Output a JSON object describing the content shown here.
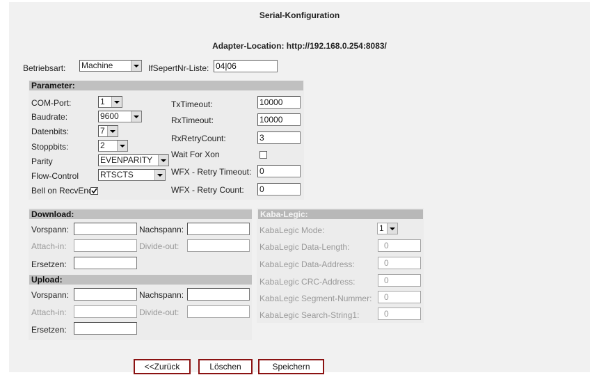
{
  "header": {
    "title": "Serial-Konfiguration",
    "adapter_location": "Adapter-Location: http://192.168.0.254:8083/"
  },
  "top": {
    "betriebsart_label": "Betriebsart:",
    "betriebsart_value": "Machine",
    "ifsepert_label": "IfSepertNr-Liste:",
    "ifsepert_value": "04|06"
  },
  "parameter": {
    "header": "Parameter:",
    "com_port_label": "COM-Port:",
    "com_port_value": "1",
    "baudrate_label": "Baudrate:",
    "baudrate_value": "9600",
    "datenbits_label": "Datenbits:",
    "datenbits_value": "7",
    "stoppbits_label": "Stoppbits:",
    "stoppbits_value": "2",
    "parity_label": "Parity",
    "parity_value": "EVENPARITY",
    "flow_control_label": "Flow-Control",
    "flow_control_value": "RTSCTS",
    "bell_label": "Bell on RecvEnd",
    "bell_checked": true,
    "tx_timeout_label": "TxTimeout:",
    "tx_timeout_value": "10000",
    "rx_timeout_label": "RxTimeout:",
    "rx_timeout_value": "10000",
    "rx_retry_label": "RxRetryCount:",
    "rx_retry_value": "3",
    "wait_xon_label": "Wait For Xon",
    "wait_xon_checked": false,
    "wfx_timeout_label": "WFX - Retry Timeout:",
    "wfx_timeout_value": "0",
    "wfx_count_label": "WFX - Retry Count:",
    "wfx_count_value": "0"
  },
  "download": {
    "header": "Download:",
    "vorspann_label": "Vorspann:",
    "vorspann_value": "",
    "nachspann_label": "Nachspann:",
    "nachspann_value": "",
    "attach_label": "Attach-in:",
    "attach_value": "",
    "divide_label": "Divide-out:",
    "divide_value": "",
    "ersetzen_label": "Ersetzen:",
    "ersetzen_value": ""
  },
  "upload": {
    "header": "Upload:",
    "vorspann_label": "Vorspann:",
    "vorspann_value": "",
    "nachspann_label": "Nachspann:",
    "nachspann_value": "",
    "attach_label": "Attach-in:",
    "attach_value": "",
    "divide_label": "Divide-out:",
    "divide_value": "",
    "ersetzen_label": "Ersetzen:",
    "ersetzen_value": ""
  },
  "kabalegic": {
    "header": "Kaba-Legic:",
    "mode_label": "KabaLegic Mode:",
    "mode_value": "1",
    "data_length_label": "KabaLegic Data-Length:",
    "data_length_value": "0",
    "data_address_label": "KabaLegic Data-Address:",
    "data_address_value": "0",
    "crc_address_label": "KabaLegic CRC-Address:",
    "crc_address_value": "0",
    "segment_label": "KabaLegic Segment-Nummer:",
    "segment_value": "0",
    "search_label": "KabaLegic Search-String1:",
    "search_value": "0"
  },
  "buttons": {
    "back": "<<Zurück",
    "delete": "Löschen",
    "save": "Speichern"
  },
  "colors": {
    "page_bg": "#f1f1f1",
    "section_header": "#c0c0c0",
    "button_border": "#8b1212"
  }
}
